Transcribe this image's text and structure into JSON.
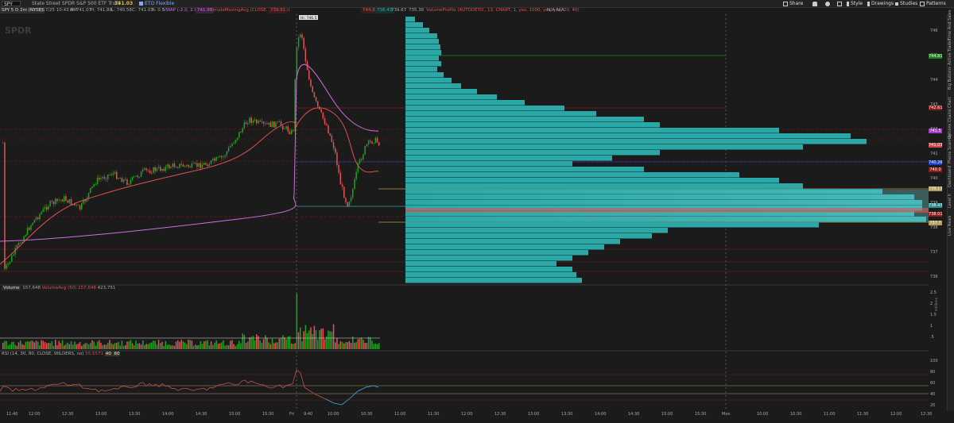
{
  "topbar": {
    "symbol": "SPY",
    "company": "State Street SPDR S&P 500 ETF Trust",
    "last": "741.03",
    "extra": "ETO Flexible",
    "buttons": [
      "Share",
      "Style",
      "Drawings",
      "Studies",
      "Patterns"
    ]
  },
  "infobar": {
    "chart_id": "SPY 5 D 2m (NYSE)",
    "date": "D: 7/17/25 10:43 AM",
    "open": "O: 741.07",
    "high": "H: 741.88",
    "low": "L: 740.58",
    "close": "C: 741.03",
    "range": "R: 0.5",
    "vwap_label": "VWAP (-2.0, 2.0, DAY)",
    "vwap_value": "741.97",
    "sma_label": "SimpleMovingAvg (CLOSE, 20, 0, no)",
    "sma_value": "739.81",
    "vp1": "744.81",
    "vp2": "738.43",
    "vp3": "739.67",
    "vp4": "735.36",
    "vp_label": "VolumeProfile (AUTODETIC, 13, CHART, 1, yes, 1000, yes, yes, 20, 40)",
    "na1": "N/A",
    "na2": "N/A"
  },
  "volume_panel": {
    "label": "Volume",
    "value": "157,648",
    "avg_label": "VolumeAvg (50)",
    "avg_value": "157,648",
    "extra": "423,751"
  },
  "rsi_panel": {
    "label": "RSI (14, 30, 80, CLOSE, WILDERS, no)",
    "value": "55.5571",
    "levels": [
      "40",
      "60"
    ]
  },
  "price_axis": [
    "746",
    "745",
    "744",
    "743",
    "742",
    "741",
    "740",
    "739",
    "738",
    "737",
    "736"
  ],
  "price_tags": [
    {
      "text": "744.81",
      "color": "#1e7d1e"
    },
    {
      "text": "742.61",
      "color": "#8b1a1a"
    },
    {
      "text": "741.5",
      "color": "#a03cbe"
    },
    {
      "text": "741.03",
      "color": "#c84848"
    },
    {
      "text": "740.26",
      "color": "#1e3cbe"
    },
    {
      "text": "740.0",
      "color": "#8b1a1a"
    },
    {
      "text": "739.13",
      "color": "#b49b5a"
    },
    {
      "text": "738.43",
      "color": "#2a8a8a"
    },
    {
      "text": "738.01",
      "color": "#8b1a1a"
    },
    {
      "text": "737.7",
      "color": "#b49b5a"
    }
  ],
  "volume_axis": [
    "2.5",
    "2",
    "1.5",
    "1",
    ".5"
  ],
  "volume_unit": "millions",
  "rsi_axis": [
    "100",
    "80",
    "60",
    "40",
    "20"
  ],
  "time_axis": [
    "11:40",
    "12:00",
    "12:30",
    "13:00",
    "13:30",
    "14:00",
    "14:30",
    "15:00",
    "15:30",
    "Fri",
    "9:40",
    "10:00",
    "10:30",
    "11:00",
    "11:30",
    "12:00",
    "12:30",
    "13:00",
    "13:30",
    "14:00",
    "14:30",
    "15:00",
    "15:30",
    "Mon",
    "10:00",
    "10:30",
    "11:00",
    "11:30",
    "12:00",
    "12:30"
  ],
  "right_tabs": [
    "Time And Sales",
    "Active Trader",
    "Big Buttons",
    "Chart",
    "Options Chains",
    "Phone Scanner",
    "Dashboard",
    "Level II",
    "Live News"
  ],
  "annotation": "Hi: 746.5",
  "colors": {
    "up": "#1ea51e",
    "down": "#e05656",
    "vwap": "#d070e0",
    "sma": "#e05050",
    "profile": "#2aa8a8",
    "poc": "#c84848"
  }
}
